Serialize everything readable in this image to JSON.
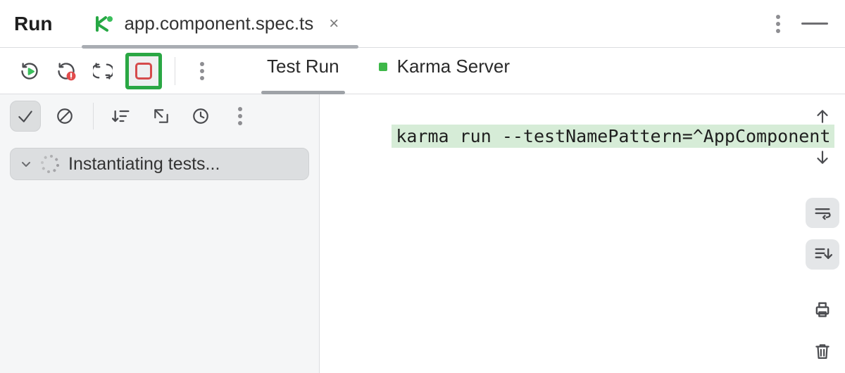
{
  "header": {
    "tool_title": "Run",
    "file_tab": {
      "name": "app.component.spec.ts"
    }
  },
  "toolbar": {
    "tabs": [
      {
        "label": "Test Run",
        "active": true,
        "indicator": null
      },
      {
        "label": "Karma Server",
        "active": false,
        "indicator": "green"
      }
    ]
  },
  "tree": {
    "root_label": "Instantiating tests...",
    "status": "loading"
  },
  "console": {
    "command": "karma run --testNamePattern=^AppComponent"
  },
  "icons": {
    "rerun": "rerun-icon",
    "rerun_failed": "rerun-failed-icon",
    "toggle_autotest": "toggle-auto-test-icon",
    "stop": "stop-icon",
    "more": "more-icon",
    "show_passed": "check-icon",
    "show_ignored": "disabled-icon",
    "sort": "sort-icon",
    "expand_all": "expand-all-icon",
    "history": "history-icon",
    "prev": "arrow-up-icon",
    "next": "arrow-down-icon",
    "soft_wrap": "soft-wrap-icon",
    "scroll_end": "scroll-to-end-icon",
    "print": "print-icon",
    "delete": "trash-icon",
    "minimize": "minimize-icon",
    "close": "close-icon"
  }
}
